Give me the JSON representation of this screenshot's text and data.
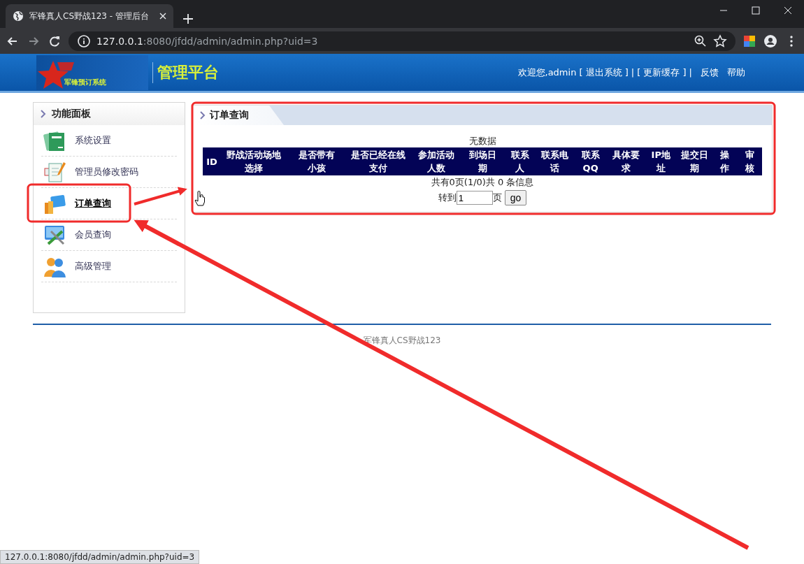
{
  "browser": {
    "tab_title": "军锋真人CS野战123 - 管理后台",
    "url_host": "127.0.0.1",
    "url_rest": ":8080/jfdd/admin/admin.php?uid=3",
    "status_url": "127.0.0.1:8080/jfdd/admin/admin.php?uid=3"
  },
  "header": {
    "logo_text": "军锋预订系统",
    "platform_title": "管理平台",
    "welcome": "欢迎您,admin",
    "links": [
      {
        "kind": "link",
        "label": "[ 退出系统 ]"
      },
      {
        "kind": "sep",
        "label": "|"
      },
      {
        "kind": "link",
        "label": "[ 更新缓存 ]"
      },
      {
        "kind": "sep",
        "label": "|"
      },
      {
        "kind": "link",
        "label": "反馈"
      },
      {
        "kind": "link",
        "label": "帮助"
      }
    ]
  },
  "sidebar": {
    "title": "功能面板",
    "items": [
      {
        "label": "系统设置",
        "selected": false
      },
      {
        "label": "管理员修改密码",
        "selected": false
      },
      {
        "label": "订单查询",
        "selected": true
      },
      {
        "label": "会员查询",
        "selected": false
      },
      {
        "label": "高级管理",
        "selected": false
      }
    ]
  },
  "panel": {
    "title": "订单查询",
    "empty_message": "无数据",
    "table": {
      "columns": [
        "ID",
        "野战活动场地选择",
        "是否带有小孩",
        "是否已经在线支付",
        "参加活动人数",
        "到场日期",
        "联系人",
        "联系电话",
        "联系QQ",
        "具体要求",
        "IP地址",
        "提交日期",
        "操作",
        "审核"
      ]
    },
    "pager": {
      "summary": "共有0页(1/0)共 0  条信息",
      "goto_label": "转到",
      "page_value": "1",
      "page_unit": "页",
      "go_button": "go"
    }
  },
  "footer": {
    "text": "军锋真人CS野战123"
  }
}
